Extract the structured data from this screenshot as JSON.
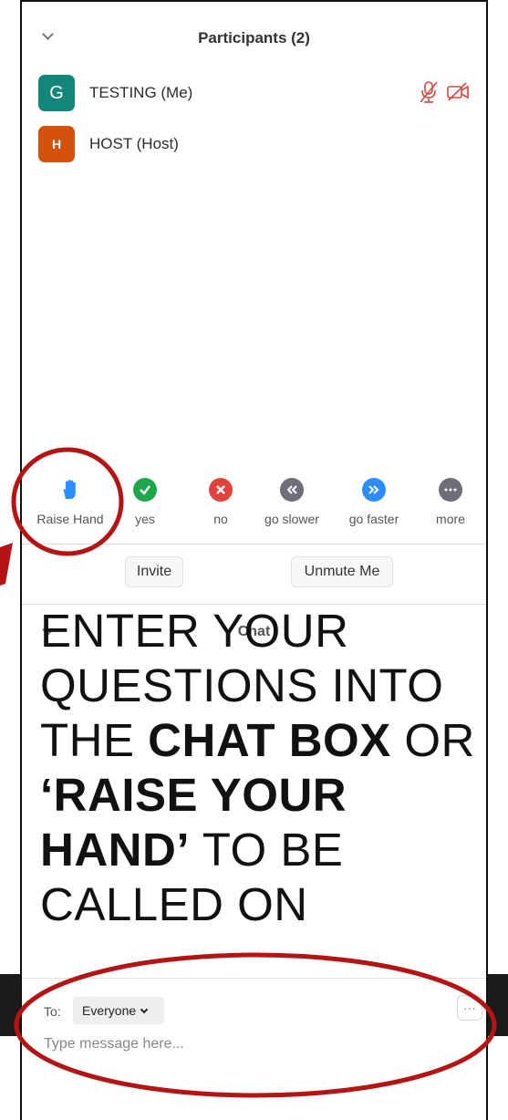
{
  "participants_panel": {
    "title": "Participants (2)",
    "participants": [
      {
        "initial": "G",
        "name": "TESTING (Me)",
        "color": "#14857a"
      },
      {
        "initial": "H",
        "name": "HOST (Host)",
        "color": "#d4520d"
      }
    ]
  },
  "reactions": [
    {
      "label": "Raise Hand",
      "icon": "hand-icon",
      "color": "#2d8cff"
    },
    {
      "label": "yes",
      "icon": "check-icon",
      "color": "#1fa64b"
    },
    {
      "label": "no",
      "icon": "x-icon",
      "color": "#e0433b"
    },
    {
      "label": "go slower",
      "icon": "rewind-icon",
      "color": "#6e6e7a"
    },
    {
      "label": "go faster",
      "icon": "fast-forward-icon",
      "color": "#2d8cff"
    },
    {
      "label": "more",
      "icon": "ellipsis-icon",
      "color": "#6e6e7a"
    }
  ],
  "buttons": {
    "invite": "Invite",
    "unmute": "Unmute Me"
  },
  "chat": {
    "title": "Chat",
    "to_label": "To:",
    "recipient": "Everyone",
    "more": "···",
    "placeholder": "Type message here..."
  },
  "overlay": {
    "p1": "ENTER YOUR QUESTIONS INTO THE ",
    "b1": "CHAT BOX",
    "p2": " OR ",
    "b2": "‘RAISE YOUR HAND’",
    "p3": " TO BE CALLED ON"
  },
  "colors": {
    "annotation_red": "#b41414"
  }
}
